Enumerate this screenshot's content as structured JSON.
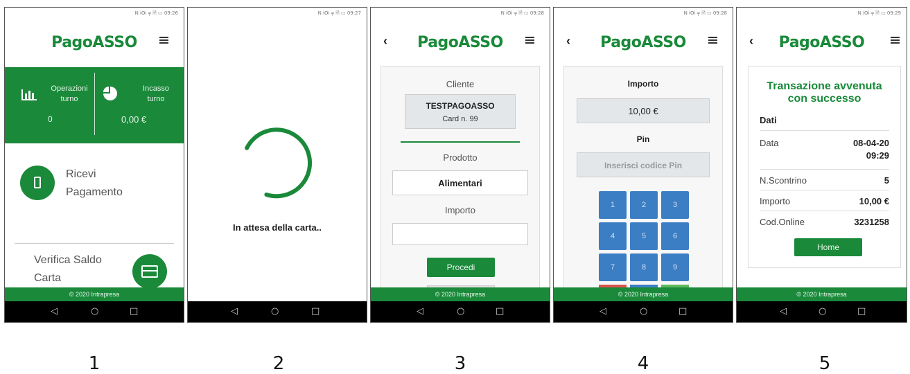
{
  "status_time": [
    "09:26",
    "09:27",
    "09:28",
    "09:28",
    "09:29"
  ],
  "status_icons": "N iOi ╤ 🗎 ▭",
  "app_title": "PagoASSO",
  "footer": "© 2020 Intrapresa",
  "screen1": {
    "stat1_label": "Operazioni turno",
    "stat1_value": "0",
    "stat2_label": "Incasso turno",
    "stat2_value": "0,00 €",
    "receive_line1": "Ricevi",
    "receive_line2": "Pagamento",
    "verify_line1": "Verifica Saldo",
    "verify_line2": "Carta"
  },
  "screen2": {
    "waiting_text": "In attesa della carta.."
  },
  "screen3": {
    "cliente_label": "Cliente",
    "client_name": "TESTPAGOASSO",
    "card_number": "Card n. 99",
    "prodotto_label": "Prodotto",
    "product_value": "Alimentari",
    "importo_label": "Importo",
    "importo_value": "",
    "procedi_label": "Procedi"
  },
  "screen4": {
    "importo_label": "Importo",
    "importo_value": "10,00 €",
    "pin_label": "Pin",
    "pin_placeholder": "Inserisci codice Pin",
    "keys": [
      "1",
      "2",
      "3",
      "4",
      "5",
      "6",
      "7",
      "8",
      "9"
    ]
  },
  "screen5": {
    "success_line1": "Transazione avvenuta",
    "success_line2": "con successo",
    "dati_label": "Dati",
    "rows": [
      {
        "label": "Data",
        "value_line1": "08-04-20",
        "value_line2": "09:29"
      },
      {
        "label": "N.Scontrino",
        "value_line1": "5"
      },
      {
        "label": "Importo",
        "value_line1": "10,00 €"
      },
      {
        "label": "Cod.Online",
        "value_line1": "3231258"
      }
    ],
    "home_label": "Home"
  },
  "captions": [
    "1",
    "2",
    "3",
    "4",
    "5"
  ],
  "colors": {
    "brand_green": "#1a8a3a",
    "key_blue": "#3b7ec4"
  }
}
